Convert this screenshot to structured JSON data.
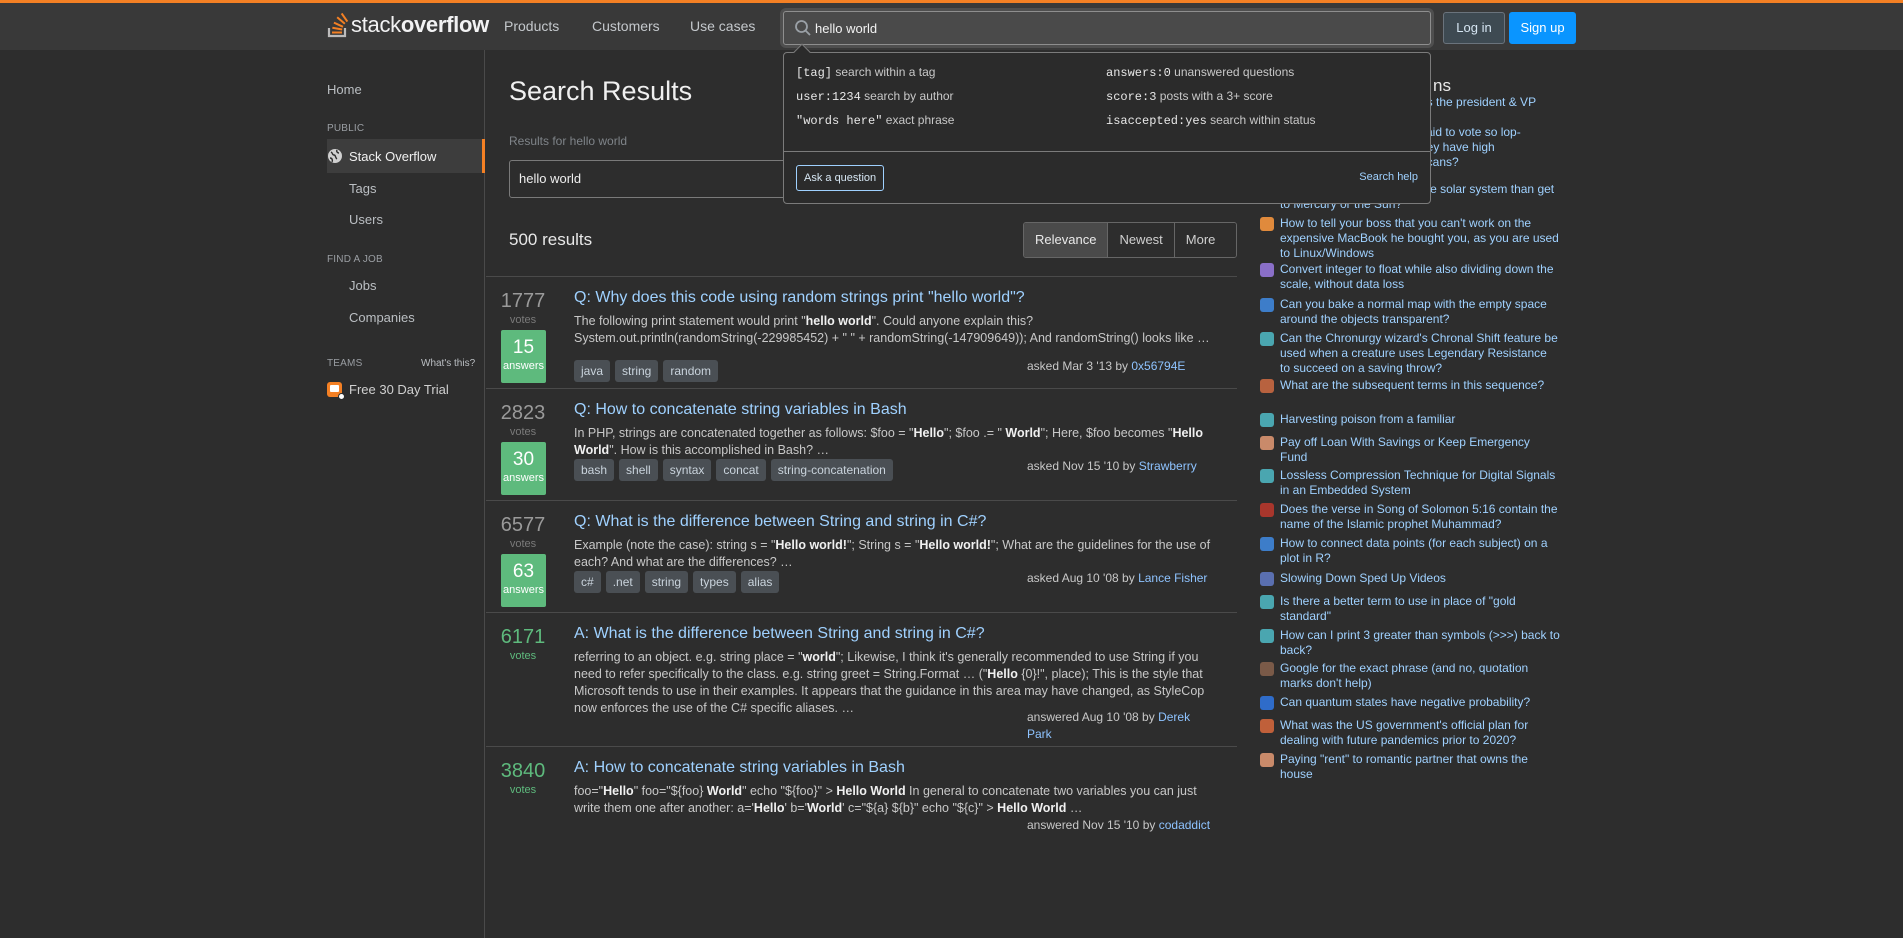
{
  "header": {
    "logo": {
      "light": "stack",
      "bold": "overflow"
    },
    "nav": [
      "Products",
      "Customers",
      "Use cases"
    ],
    "search_value": "hello world",
    "login": "Log in",
    "signup": "Sign up"
  },
  "search_popover": {
    "hints": [
      {
        "code": "[tag]",
        "text": "search within a tag"
      },
      {
        "code": "answers:0",
        "text": "unanswered questions"
      },
      {
        "code": "user:1234",
        "text": "search by author"
      },
      {
        "code": "score:3",
        "text": "posts with a 3+ score"
      },
      {
        "code": "\"words here\"",
        "text": "exact phrase"
      },
      {
        "code": "isaccepted:yes",
        "text": "search within status"
      }
    ],
    "ask_button": "Ask a question",
    "help_link": "Search help"
  },
  "sidebar": {
    "home": "Home",
    "public_heading": "PUBLIC",
    "stackoverflow": "Stack Overflow",
    "tags": "Tags",
    "users": "Users",
    "find_job_heading": "FIND A JOB",
    "jobs": "Jobs",
    "companies": "Companies",
    "teams_heading": "TEAMS",
    "whats_this": "What's this?",
    "free_trial": "Free 30 Day Trial"
  },
  "main": {
    "title": "Search Results",
    "results_for": "Results for hello world",
    "search_value": "hello world",
    "count": "500 results",
    "sort": [
      "Relevance",
      "Newest",
      "More"
    ],
    "results": [
      {
        "votes": "1777",
        "votes_label": "votes",
        "answers": "15",
        "answers_label": "answers",
        "title": "Q: Why does this code using random strings print \"hello world\"?",
        "excerpt": [
          "The following print statement would print \"",
          "hello world",
          "\". Could anyone explain this? System.out.println(randomString(-229985452) + \" \" + randomString(-147909649)); And randomString() looks like …"
        ],
        "tags": [
          "java",
          "string",
          "random"
        ],
        "meta_prefix": "asked Mar 3 '13 by",
        "author": "0x56794E"
      },
      {
        "votes": "2823",
        "votes_label": "votes",
        "answers": "30",
        "answers_label": "answers",
        "title": "Q: How to concatenate string variables in Bash",
        "excerpt": [
          "In PHP, strings are concatenated together as follows: $foo = \"",
          "Hello",
          "\"; $foo .= \" ",
          "World",
          "\"; Here, $foo becomes \"",
          "Hello World",
          "\". How is this accomplished in Bash? …"
        ],
        "tags": [
          "bash",
          "shell",
          "syntax",
          "concat",
          "string-concatenation"
        ],
        "meta_prefix": "asked Nov 15 '10 by",
        "author": "Strawberry"
      },
      {
        "votes": "6577",
        "votes_label": "votes",
        "answers": "63",
        "answers_label": "answers",
        "title": "Q: What is the difference between String and string in C#?",
        "excerpt": [
          "Example (note the case): string s = \"",
          "Hello world!",
          "\"; String s = \"",
          "Hello world!",
          "\"; What are the guidelines for the use of each? And what are the differences? …"
        ],
        "tags": [
          "c#",
          ".net",
          "string",
          "types",
          "alias"
        ],
        "meta_prefix": "asked Aug 10 '08 by",
        "author": "Lance Fisher"
      },
      {
        "votes": "6171",
        "votes_label": "votes",
        "title": "A: What is the difference between String and string in C#?",
        "excerpt": [
          "referring to an object. e.g. string place = \"",
          "world",
          "\"; Likewise, I think it's generally recommended to use String if you need to refer specifically to the class. e.g. string greet = String.Format … (\"",
          "Hello",
          " {0}!\", place); This is the style that Microsoft tends to use in their examples. It appears that the guidance in this area may have changed, as StyleCop now enforces the use of the C# specific aliases. …"
        ],
        "meta_prefix": "answered Aug 10 '08 by",
        "author": "Derek Park"
      },
      {
        "votes": "3840",
        "votes_label": "votes",
        "title": "A: How to concatenate string variables in Bash",
        "excerpt": [
          "foo=\"",
          "Hello",
          "\" foo=\"${foo} ",
          "World",
          "\" echo \"${foo}\" > ",
          "Hello World",
          " In general to concatenate two variables you can just write them one after another: a='",
          "Hello",
          "' b='",
          "World",
          "' c=\"${a} ${b}\" echo \"${c}\" > ",
          "Hello World",
          " …"
        ],
        "meta_prefix": "answered Nov 15 '10 by",
        "author": "codaddict"
      }
    ]
  },
  "hot_network": {
    "title_visible": "ns",
    "items": [
      {
        "text": "es the president & VP",
        "color": "#9fd1ff",
        "icon": "partial"
      },
      {
        "text": "said to vote so lop-\nhey have high\nricans?",
        "color": "#9fd1ff",
        "icon": "partial"
      },
      {
        "text": "Why is it easier to escape the solar system than get to Mercury or the Sun?",
        "color": "#c0603a",
        "icon": "space-icon"
      },
      {
        "text": "How to tell your boss that you can't work on the expensive MacBook he bought you, as you are used to Linux/Windows",
        "color": "#e08a3c",
        "icon": "workplace-icon"
      },
      {
        "text": "Convert integer to float while also dividing down the scale, without data loss",
        "color": "#8a6fc8",
        "icon": "codegolf-icon"
      },
      {
        "text": "Can you bake a normal map with the empty space around the objects transparent?",
        "color": "#3d7dc9",
        "icon": "blender-icon"
      },
      {
        "text": "Can the Chronurgy wizard's Chronal Shift feature be used when a creature uses Legendary Resistance to succeed on a saving throw?",
        "color": "#4aa6b0",
        "icon": "rpg-icon"
      },
      {
        "text": "What are the subsequent terms in this sequence?",
        "color": "#b8623f",
        "icon": "puzzling-icon"
      },
      {
        "text": "Harvesting poison from a familiar",
        "color": "#4aa6b0",
        "icon": "rpg-icon"
      },
      {
        "text": "Pay off Loan With Savings or Keep Emergency Fund",
        "color": "#c98a6a",
        "icon": "money-icon"
      },
      {
        "text": "Lossless Compression Technique for Digital Signals in an Embedded System",
        "color": "#4aa6b0",
        "icon": "dsp-icon"
      },
      {
        "text": "Does the verse in Song of Solomon 5:16 contain the name of the Islamic prophet Muhammad?",
        "color": "#a8362c",
        "icon": "islam-icon"
      },
      {
        "text": "How to connect data points (for each subject) on a plot in R?",
        "color": "#3d7dc9",
        "icon": "stats-icon"
      },
      {
        "text": "Slowing Down Sped Up Videos",
        "color": "#5a6fb0",
        "icon": "video-icon"
      },
      {
        "text": "Is there a better term to use in place of \"gold standard\"",
        "color": "#4aa6b0",
        "icon": "ell-icon"
      },
      {
        "text": "How can I print 3 greater than symbols (>>>) back to back?",
        "color": "#4aa6b0",
        "icon": "tex-icon"
      },
      {
        "text": "Google for the exact phrase (and no, quotation marks don't help)",
        "color": "#7a5a48",
        "icon": "webapps-icon"
      },
      {
        "text": "Can quantum states have negative probability?",
        "color": "#2f6cc9",
        "icon": "quantum-icon"
      },
      {
        "text": "What was the US government's official plan for dealing with future pandemics prior to 2020?",
        "color": "#c0603a",
        "icon": "politics-icon"
      },
      {
        "text": "Paying \"rent\" to romantic partner that owns the house",
        "color": "#c98a6a",
        "icon": "money-icon"
      }
    ]
  }
}
